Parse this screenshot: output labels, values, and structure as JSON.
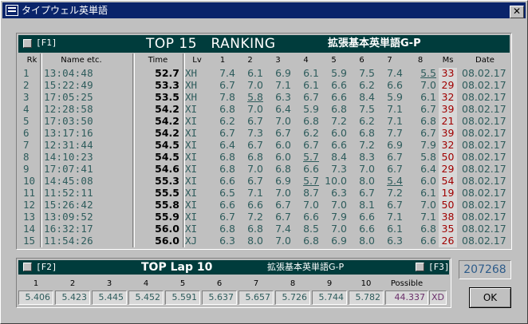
{
  "window": {
    "title": "タイプウェル英単語",
    "close_glyph": "✕"
  },
  "ranking": {
    "hotkey": "[F1]",
    "title": "TOP 15　RANKING",
    "subtitle": "拡張基本英単語G-P",
    "headers": [
      "Rk",
      "Name etc.",
      "Time",
      "Lv",
      "1",
      "2",
      "3",
      "4",
      "5",
      "6",
      "7",
      "8",
      "Ms",
      "Date"
    ],
    "rows": [
      {
        "rk": "1",
        "name": "13:04:48",
        "time": "52.7",
        "lv": "XH",
        "s": [
          "7.4",
          "6.1",
          "6.9",
          "6.1",
          "5.9",
          "7.5",
          "7.4",
          "5.5"
        ],
        "ms": "33",
        "date": "08.02.17",
        "u": [
          7
        ]
      },
      {
        "rk": "2",
        "name": "15:22:49",
        "time": "53.3",
        "lv": "XH",
        "s": [
          "6.7",
          "7.0",
          "7.1",
          "6.1",
          "6.6",
          "6.2",
          "6.6",
          "7.0"
        ],
        "ms": "29",
        "date": "08.02.17",
        "u": []
      },
      {
        "rk": "3",
        "name": "17:05:25",
        "time": "53.5",
        "lv": "XH",
        "s": [
          "7.8",
          "5.8",
          "6.3",
          "6.7",
          "6.6",
          "8.4",
          "5.9",
          "6.1"
        ],
        "ms": "32",
        "date": "08.02.17",
        "u": [
          1
        ]
      },
      {
        "rk": "4",
        "name": "12:28:58",
        "time": "54.2",
        "lv": "XI",
        "s": [
          "6.8",
          "7.0",
          "6.4",
          "5.9",
          "6.8",
          "7.5",
          "7.1",
          "6.7"
        ],
        "ms": "39",
        "date": "08.02.17",
        "u": []
      },
      {
        "rk": "5",
        "name": "17:03:50",
        "time": "54.2",
        "lv": "XI",
        "s": [
          "6.2",
          "6.7",
          "7.0",
          "6.8",
          "7.2",
          "6.2",
          "7.1",
          "6.8"
        ],
        "ms": "21",
        "date": "08.02.17",
        "u": []
      },
      {
        "rk": "6",
        "name": "13:17:16",
        "time": "54.2",
        "lv": "XI",
        "s": [
          "6.7",
          "7.3",
          "6.7",
          "6.2",
          "6.0",
          "6.8",
          "7.7",
          "6.7"
        ],
        "ms": "39",
        "date": "08.02.17",
        "u": []
      },
      {
        "rk": "7",
        "name": "12:31:44",
        "time": "54.5",
        "lv": "XI",
        "s": [
          "6.4",
          "6.7",
          "6.0",
          "6.7",
          "6.6",
          "7.2",
          "6.9",
          "7.9"
        ],
        "ms": "32",
        "date": "08.02.17",
        "u": []
      },
      {
        "rk": "8",
        "name": "14:10:23",
        "time": "54.5",
        "lv": "XI",
        "s": [
          "6.8",
          "6.8",
          "6.0",
          "5.7",
          "8.4",
          "8.3",
          "6.7",
          "5.8"
        ],
        "ms": "50",
        "date": "08.02.17",
        "u": [
          3
        ]
      },
      {
        "rk": "9",
        "name": "17:07:41",
        "time": "54.6",
        "lv": "XI",
        "s": [
          "6.8",
          "7.0",
          "6.8",
          "6.6",
          "7.3",
          "7.0",
          "6.7",
          "6.4"
        ],
        "ms": "29",
        "date": "08.02.17",
        "u": []
      },
      {
        "rk": "10",
        "name": "14:45:08",
        "time": "55.3",
        "lv": "XI",
        "s": [
          "6.6",
          "6.7",
          "6.9",
          "5.7",
          "10.0",
          "8.0",
          "5.4",
          "6.0"
        ],
        "ms": "54",
        "date": "08.02.17",
        "u": [
          3,
          6
        ]
      },
      {
        "rk": "11",
        "name": "11:52:11",
        "time": "55.5",
        "lv": "XI",
        "s": [
          "6.5",
          "7.1",
          "7.0",
          "8.7",
          "6.3",
          "6.7",
          "7.2",
          "6.1"
        ],
        "ms": "19",
        "date": "08.02.17",
        "u": []
      },
      {
        "rk": "12",
        "name": "15:26:42",
        "time": "55.8",
        "lv": "XI",
        "s": [
          "6.6",
          "6.6",
          "6.7",
          "7.0",
          "7.0",
          "8.1",
          "6.7",
          "7.0"
        ],
        "ms": "50",
        "date": "08.02.17",
        "u": []
      },
      {
        "rk": "13",
        "name": "13:09:52",
        "time": "55.9",
        "lv": "XI",
        "s": [
          "6.7",
          "7.2",
          "6.7",
          "6.6",
          "7.9",
          "6.6",
          "7.1",
          "7.1"
        ],
        "ms": "38",
        "date": "08.02.17",
        "u": []
      },
      {
        "rk": "14",
        "name": "16:32:17",
        "time": "56.0",
        "lv": "XI",
        "s": [
          "6.8",
          "6.8",
          "7.4",
          "8.5",
          "7.0",
          "6.6",
          "6.1",
          "6.8"
        ],
        "ms": "35",
        "date": "08.02.17",
        "u": []
      },
      {
        "rk": "15",
        "name": "11:54:26",
        "time": "56.0",
        "lv": "XJ",
        "s": [
          "6.3",
          "8.0",
          "7.0",
          "6.8",
          "6.9",
          "8.0",
          "6.3",
          "6.6"
        ],
        "ms": "26",
        "date": "08.02.17",
        "u": []
      }
    ]
  },
  "top_lap": {
    "hotkey_left": "[F2]",
    "title": "TOP Lap 10",
    "subtitle": "拡張基本英単語G-P",
    "hotkey_right": "[F3]",
    "labels": [
      "1",
      "2",
      "3",
      "4",
      "5",
      "6",
      "7",
      "8",
      "9",
      "10",
      "Possible"
    ],
    "values": [
      "5.406",
      "5.423",
      "5.445",
      "5.452",
      "5.591",
      "5.637",
      "5.657",
      "5.726",
      "5.744",
      "5.782",
      "44.337"
    ],
    "possible_level": "XD"
  },
  "score": "207268",
  "ok_label": "OK",
  "colors": {
    "header_bg": "#003c3c",
    "value_text": "#2e5c5c",
    "miss_text": "#a00000",
    "title_bar": "#0a246a"
  }
}
